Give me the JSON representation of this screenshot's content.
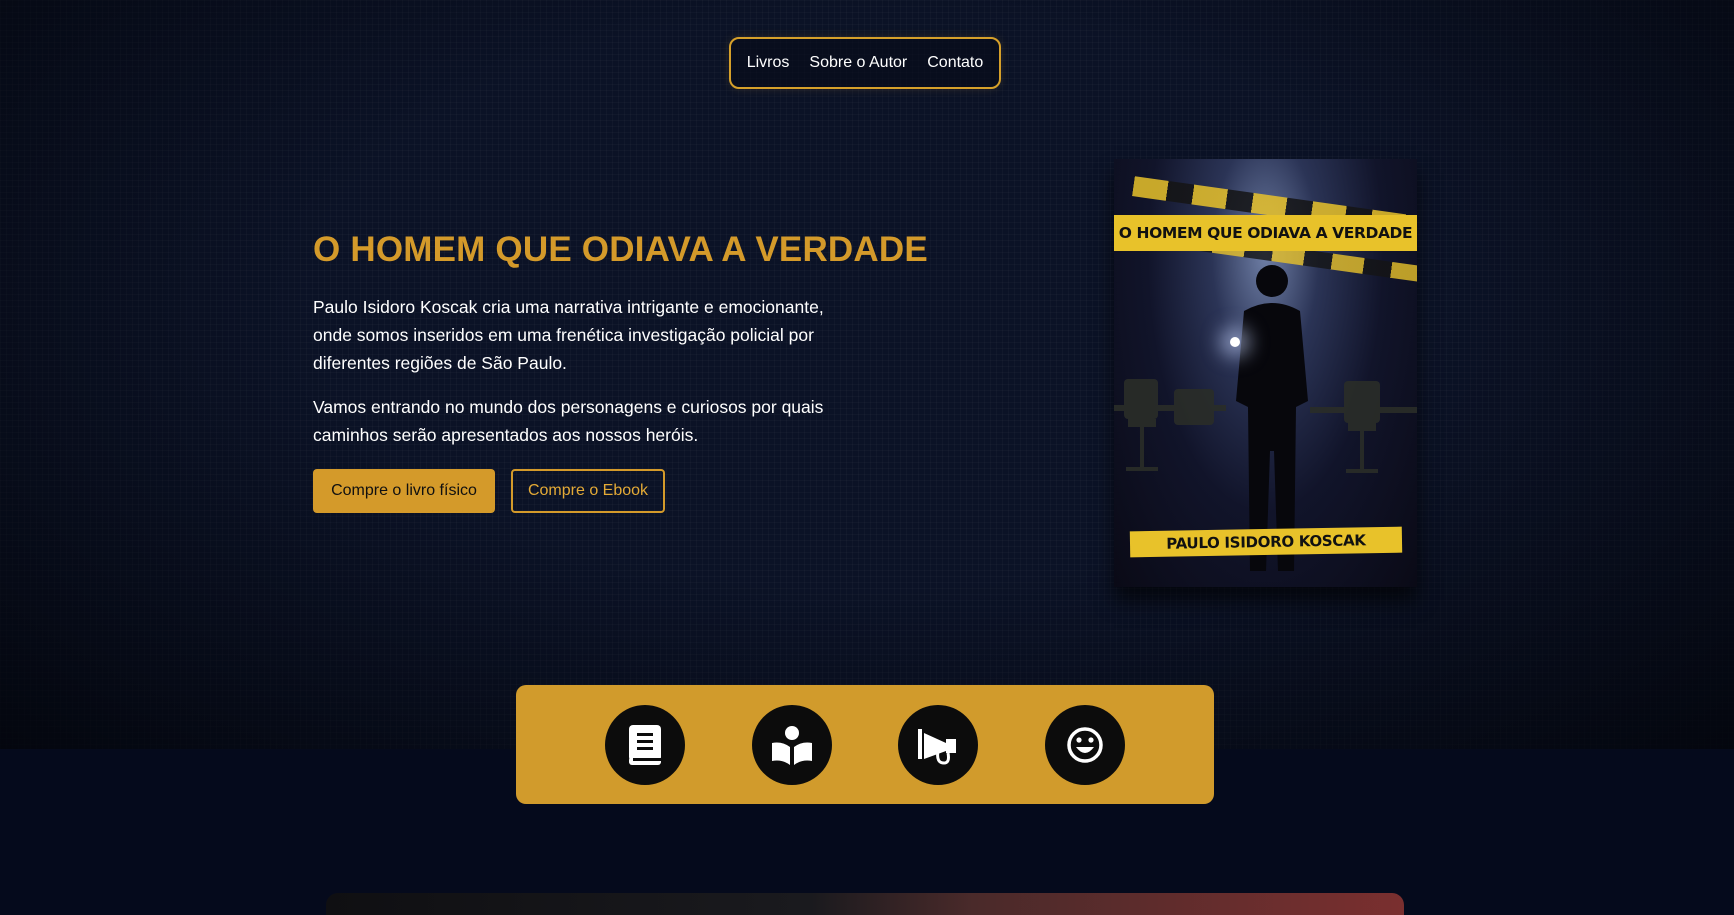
{
  "nav": {
    "items": [
      "Livros",
      "Sobre o Autor",
      "Contato"
    ]
  },
  "hero": {
    "title": "O HOMEM QUE ODIAVA A VERDADE",
    "paragraph1": "Paulo Isidoro Koscak cria uma narrativa intrigante e emocionante, onde somos inseridos em uma frenética investigação policial por diferentes regiões de São Paulo.",
    "paragraph2": "Vamos entrando no mundo dos personagens e curiosos por quais caminhos serão apresentados aos nossos heróis.",
    "button_physical": "Compre o livro físico",
    "button_ebook": "Compre o Ebook"
  },
  "cover": {
    "title": "O HOMEM QUE ODIAVA A VERDADE",
    "author": "PAULO ISIDORO KOSCAK"
  },
  "iconbar": {
    "icons": [
      "book-icon",
      "reader-icon",
      "megaphone-icon",
      "smile-icon"
    ]
  },
  "colors": {
    "accent": "#d49a2a",
    "background": "#0b1226",
    "tape": "#e8c22a"
  }
}
